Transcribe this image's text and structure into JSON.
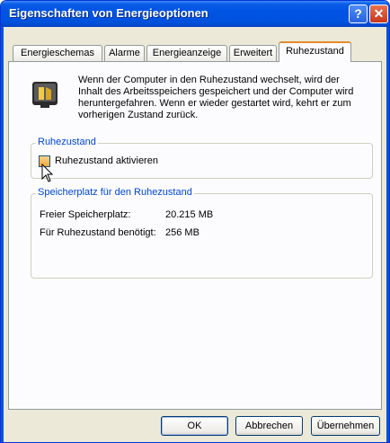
{
  "window": {
    "title": "Eigenschaften von Energieoptionen",
    "help_glyph": "?",
    "close_glyph": "✕"
  },
  "tabs": [
    {
      "label": "Energieschemas"
    },
    {
      "label": "Alarme"
    },
    {
      "label": "Energieanzeige"
    },
    {
      "label": "Erweitert"
    },
    {
      "label": "Ruhezustand",
      "active": true
    }
  ],
  "info": {
    "icon": "hibernate-monitor-icon",
    "text": "Wenn der Computer in den Ruhezustand wechselt, wird der Inhalt des Arbeitsspeichers gespeichert und der Computer wird heruntergefahren. Wenn er wieder gestartet wird, kehrt er zum vorherigen Zustand zurück."
  },
  "hibernate_group": {
    "title": "Ruhezustand",
    "checkbox_label": "Ruhezustand aktivieren",
    "checked": false
  },
  "space_group": {
    "title": "Speicherplatz für den Ruhezustand",
    "rows": [
      {
        "label": "Freier Speicherplatz:",
        "value": "20.215 MB"
      },
      {
        "label": "Für Ruhezustand benötigt:",
        "value": "256 MB"
      }
    ]
  },
  "buttons": {
    "ok": "OK",
    "cancel": "Abbrechen",
    "apply": "Übernehmen"
  },
  "colors": {
    "titlebar": "#0054e3",
    "group_title": "#0046d5",
    "tab_highlight": "#e68b2c",
    "dialog_bg": "#ece9d8"
  }
}
